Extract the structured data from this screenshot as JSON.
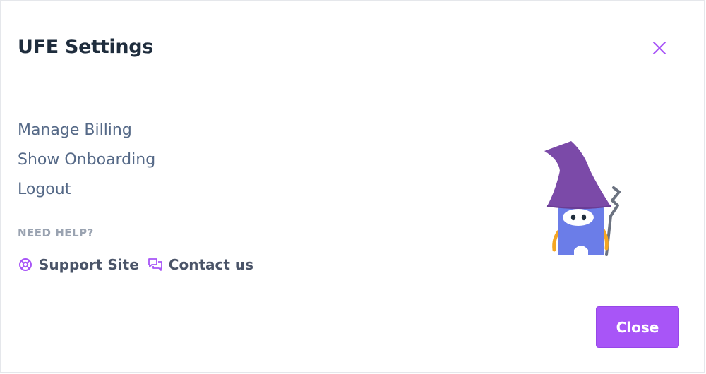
{
  "dialog": {
    "title": "UFE Settings",
    "close_icon": "close-icon"
  },
  "menu": {
    "items": [
      {
        "label": "Manage Billing"
      },
      {
        "label": "Show Onboarding"
      },
      {
        "label": "Logout"
      }
    ]
  },
  "help": {
    "heading": "NEED HELP?",
    "links": [
      {
        "label": "Support Site",
        "icon": "lifebuoy-icon"
      },
      {
        "label": "Contact us",
        "icon": "chat-bubbles-icon"
      }
    ]
  },
  "illustration": {
    "name": "wizard-mascot"
  },
  "footer": {
    "close_label": "Close"
  },
  "colors": {
    "accent": "#a855f7",
    "title": "#1f2d3d",
    "menu_text": "#556987",
    "muted": "#9aa3b1",
    "help_text": "#4a5468",
    "wizard_hat": "#7b4aa8",
    "wizard_body": "#6b7de8",
    "wizard_staff": "#6b7280",
    "wizard_arms": "#f5a623"
  }
}
